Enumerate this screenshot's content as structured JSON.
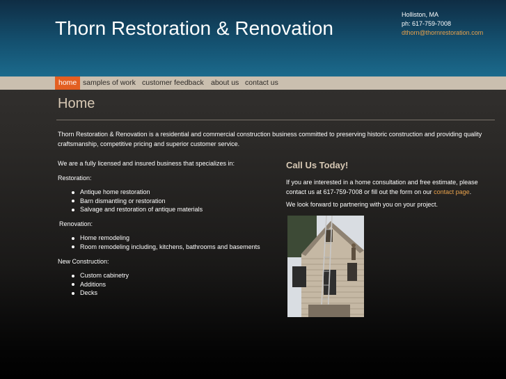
{
  "header": {
    "title": "Thorn Restoration & Renovation",
    "location": "Holliston, MA",
    "phone": "ph: 617-759-7008",
    "email": "dthorn@thornrestoration.com"
  },
  "nav": {
    "items": [
      {
        "label": "home",
        "active": true
      },
      {
        "label": "samples of work",
        "active": false
      },
      {
        "label": "customer feedback",
        "active": false
      },
      {
        "label": "about us",
        "active": false
      },
      {
        "label": "contact us",
        "active": false
      }
    ]
  },
  "main": {
    "page_title": "Home",
    "intro": "Thorn Restoration & Renovation is a residential and commercial construction business committed to preserving historic construction and providing quality craftsmanship, competitive pricing and superior customer service.",
    "licensed": "We are a fully licensed and insured business that specializes in:",
    "sections": [
      {
        "heading": "Restoration:",
        "items": [
          "Antique home restoration",
          "Barn dismantling or restoration",
          "Salvage and restoration of antique materials"
        ]
      },
      {
        "heading": "Renovation:",
        "items": [
          "Home remodeling",
          "Room remodeling including, kitchens, bathrooms and basements"
        ]
      },
      {
        "heading": "New Construction:",
        "items": [
          "Custom cabinetry",
          "Additions",
          "Decks"
        ]
      }
    ]
  },
  "call": {
    "title": "Call Us Today!",
    "text_before_link": "If you are interested in a home consultation and free estimate, please contact us at 617-759-7008 or fill out the form on our ",
    "link_text": "contact page",
    "text_after_link": ".",
    "look_forward": "We look forward to partnering with you on your project."
  },
  "colors": {
    "accent": "#e35f21",
    "link": "#e9a24c",
    "heading": "#d7c8b4",
    "nav_bg": "#cabfaf",
    "header_blue": "#1b6a8c"
  }
}
